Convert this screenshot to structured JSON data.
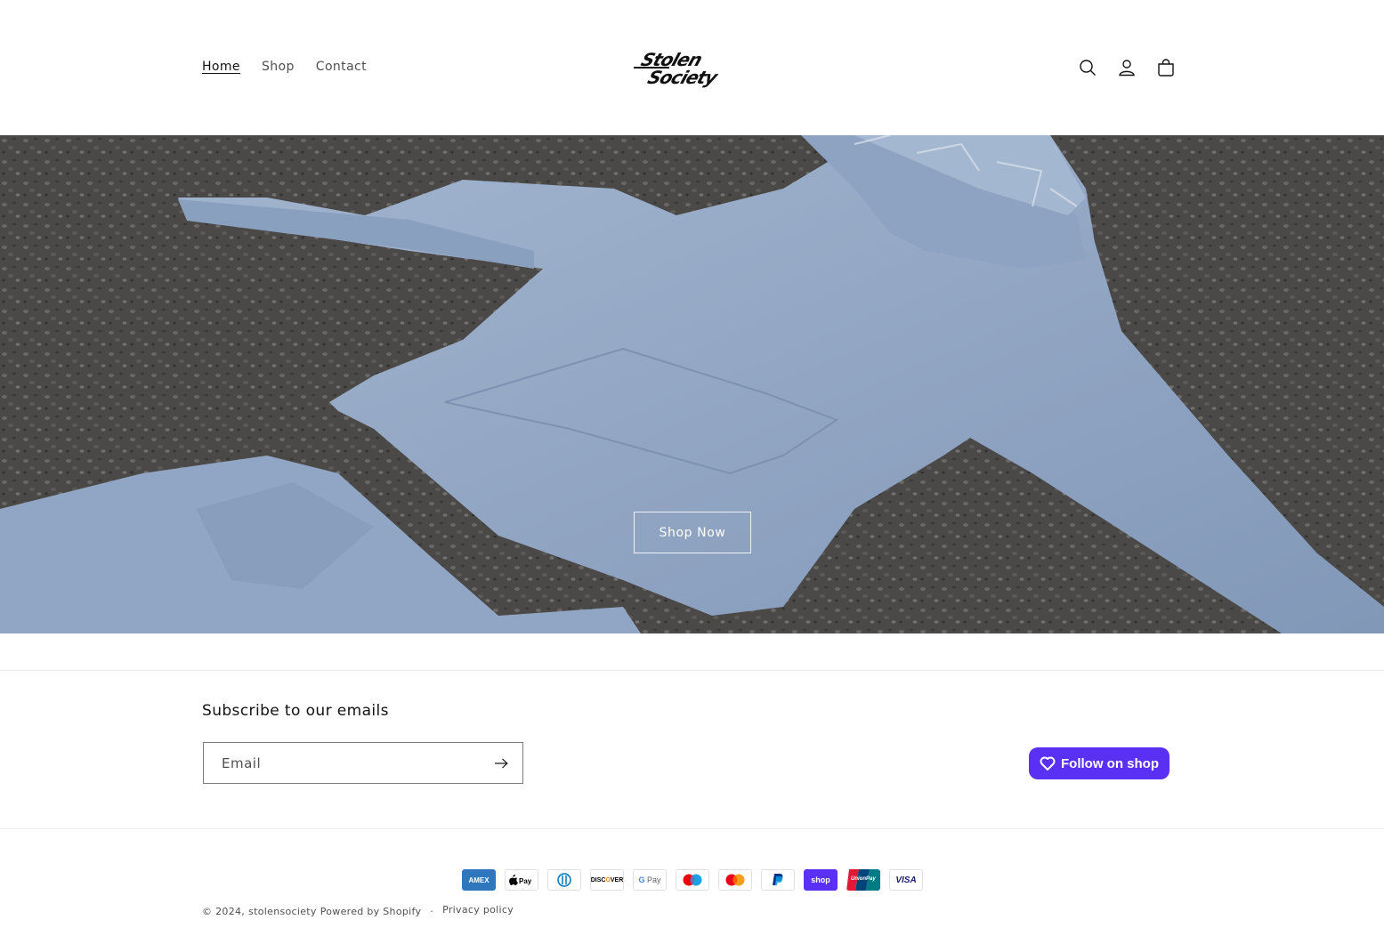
{
  "header": {
    "nav": [
      {
        "label": "Home",
        "active": true
      },
      {
        "label": "Shop",
        "active": false
      },
      {
        "label": "Contact",
        "active": false
      }
    ],
    "logo_text": "Stolen Society",
    "icons": [
      "search-icon",
      "account-icon",
      "cart-icon"
    ]
  },
  "hero": {
    "button_label": "Shop Now",
    "hoodie_color": "#93a7c3"
  },
  "newsletter": {
    "heading": "Subscribe to our emails",
    "email_placeholder": "Email",
    "follow_label": "Follow on shop"
  },
  "footer": {
    "payment_methods": [
      "American Express",
      "Apple Pay",
      "Diners Club",
      "Discover",
      "Google Pay",
      "Maestro",
      "Mastercard",
      "PayPal",
      "Shop Pay",
      "Union Pay",
      "Visa"
    ],
    "copyright": "© 2024,",
    "store_name": "stolensociety",
    "powered_by": "Powered by Shopify",
    "privacy": "Privacy policy"
  },
  "colors": {
    "accent": "#5a31f4",
    "text": "#121212"
  }
}
